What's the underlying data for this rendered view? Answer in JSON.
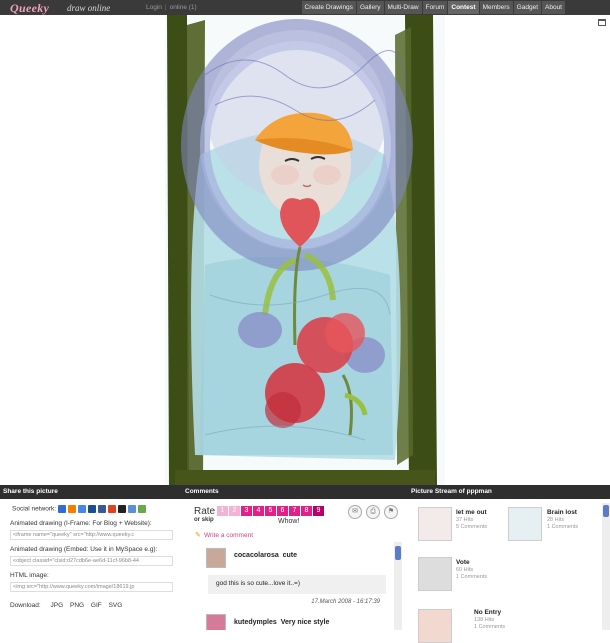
{
  "header": {
    "logo": "Queeky",
    "tagline": "draw online",
    "login": "Login",
    "online": "online (1)",
    "nav": [
      "Create Drawings",
      "Gallery",
      "Multi-Draw",
      "Forum",
      "Contest",
      "Members",
      "Gadget",
      "About"
    ],
    "active_nav": "Contest"
  },
  "share": {
    "title": "Share this picture",
    "social_label": "Social network:",
    "iframe_label": "Animated drawing (I-Frame: For Blog + Website):",
    "iframe_code": "<iframe name=\"queeky\" src=\"http://www.queeky.c",
    "object_label": "Animated drawing (Embed: Use it in MySpace e.g):",
    "object_code": "<object classid=\"clsid:d27cdb6e-ae6d-11cf-96b8-44",
    "html_label": "HTML image:",
    "html_code": "<img src=\"http://www.queeky.com/image/18619.jp",
    "download_label": "Download:",
    "formats": [
      "JPG",
      "PNG",
      "GIF",
      "SVG"
    ],
    "social_icons": [
      "delicious-icon",
      "blogger-icon",
      "google-icon",
      "digg-icon",
      "facebook-icon",
      "stumbleupon-icon",
      "myspace-icon",
      "news-icon",
      "reddit-icon"
    ]
  },
  "comments": {
    "title": "Comments",
    "rate_label": "Rate",
    "skip_label": "or skip",
    "rating_values": [
      "1",
      "2",
      "3",
      "4",
      "5",
      "6",
      "7",
      "8",
      "9"
    ],
    "rating_caption": "Whow!",
    "write_label": "Write a comment",
    "items": [
      {
        "user": "cocacolarosa",
        "title": "cute",
        "body": "god this is so cute...love it..=)",
        "date": "17.March 2008 - 16:17:39"
      },
      {
        "user": "kutedymples",
        "title": "Very nice style"
      }
    ]
  },
  "stream": {
    "title": "Picture Stream of pppman",
    "items": [
      {
        "title": "let me out",
        "hits": "37 Hits",
        "comments": "5 Comments"
      },
      {
        "title": "Brain lost",
        "hits": "28 Hits",
        "comments": "1 Comments"
      },
      {
        "title": "Vote",
        "hits": "60 Hits",
        "comments": "1 Comments"
      },
      {
        "title": "No Entry",
        "hits": "138 Hits",
        "comments": "1 Comments"
      }
    ]
  },
  "colors": {
    "topbar": "#3a3a3a",
    "accent_pink": "#e0218a",
    "link_pink": "#d8407a",
    "scroll_blue": "#5a7cc7"
  }
}
